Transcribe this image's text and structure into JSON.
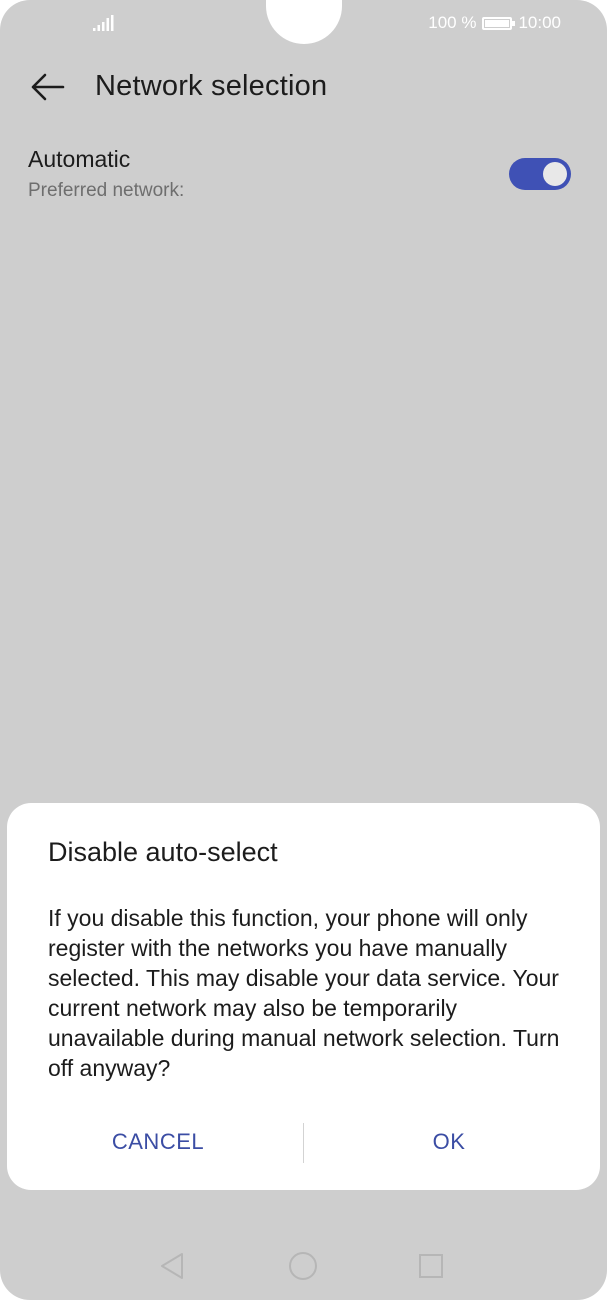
{
  "status_bar": {
    "battery_percent": "100 %",
    "battery_level": 1.0,
    "time": "10:00",
    "icons": {
      "signal": "signal-icon",
      "battery": "battery-icon"
    }
  },
  "header": {
    "title": "Network selection",
    "back_icon": "arrow-left-icon"
  },
  "setting": {
    "title": "Automatic",
    "subtitle": "Preferred network:",
    "toggle_on": true
  },
  "dialog": {
    "title": "Disable auto-select",
    "message": "If you disable this function, your phone will only register with the networks you have manually selected. This may disable your data service. Your current network may also be temporarily unavailable during manual network selection. Turn off anyway?",
    "cancel_label": "CANCEL",
    "ok_label": "OK"
  },
  "nav_bar": {
    "icons": [
      "triangle-back-icon",
      "circle-home-icon",
      "square-recents-icon"
    ]
  },
  "colors": {
    "accent": "#3f51b5",
    "button_text": "#3b4da4",
    "scrim_background": "#cecece",
    "dialog_background": "#ffffff"
  }
}
